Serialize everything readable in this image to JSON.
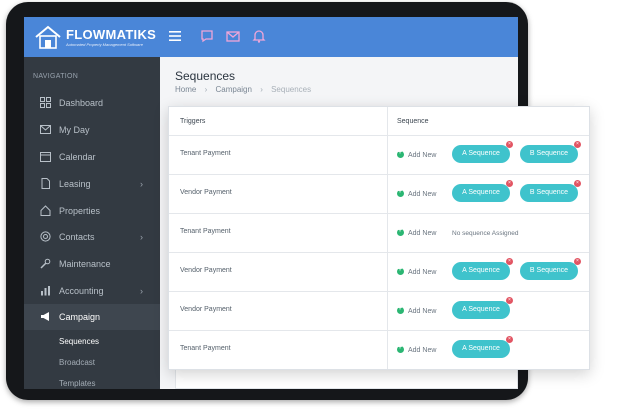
{
  "app": {
    "brand": "FLOWMATIKS",
    "tagline": "Automated Property Management Software"
  },
  "topbar": {
    "icons": [
      "menu-icon",
      "chat-icon",
      "mail-icon",
      "bell-icon"
    ]
  },
  "sidebar": {
    "heading": "NAVIGATION",
    "items": [
      {
        "label": "Dashboard",
        "icon": "grid-icon"
      },
      {
        "label": "My Day",
        "icon": "mail-icon"
      },
      {
        "label": "Calendar",
        "icon": "calendar-icon"
      },
      {
        "label": "Leasing",
        "icon": "document-icon",
        "chevron": "›"
      },
      {
        "label": "Properties",
        "icon": "home-icon"
      },
      {
        "label": "Contacts",
        "icon": "at-icon",
        "chevron": "›"
      },
      {
        "label": "Maintenance",
        "icon": "wrench-icon"
      },
      {
        "label": "Accounting",
        "icon": "bar-chart-icon",
        "chevron": "›"
      },
      {
        "label": "Campaign",
        "icon": "megaphone-icon"
      }
    ],
    "sub_items": [
      "Sequences",
      "Broadcast",
      "Templates"
    ]
  },
  "page": {
    "title": "Sequences",
    "breadcrumb": [
      "Home",
      "Campaign",
      "Sequences"
    ],
    "breadcrumb_sep": "›"
  },
  "table": {
    "headers": {
      "triggers": "Triggers",
      "sequence": "Sequence"
    },
    "add_new_label": "Add New",
    "no_sequence_text": "No sequence Assigned",
    "remove_glyph": "×",
    "rows": [
      {
        "trigger": "Tenant Payment",
        "sequences": [
          "A Sequence",
          "B Sequence"
        ]
      },
      {
        "trigger": "Vendor Payment",
        "sequences": [
          "A Sequence",
          "B Sequence"
        ]
      },
      {
        "trigger": "Tenant Payment",
        "sequences": []
      },
      {
        "trigger": "Vendor Payment",
        "sequences": [
          "A Sequence",
          "B Sequence"
        ]
      },
      {
        "trigger": "Vendor Payment",
        "sequences": [
          "A Sequence"
        ]
      },
      {
        "trigger": "Tenant Payment",
        "sequences": [
          "A Sequence"
        ]
      }
    ]
  },
  "colors": {
    "topbar": "#4a86d8",
    "sidebar": "#333a42",
    "pill": "#3fc3cc",
    "add_dot": "#2bb673",
    "remove_badge": "#e25563"
  }
}
